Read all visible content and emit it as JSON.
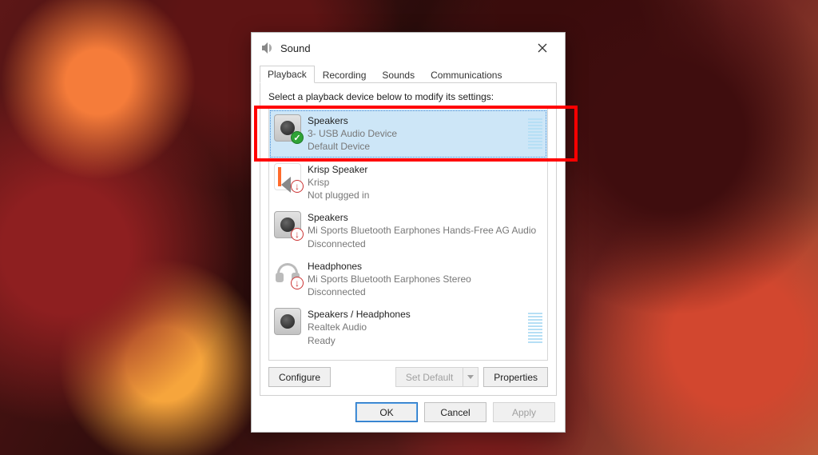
{
  "window": {
    "title": "Sound"
  },
  "tabs": [
    {
      "label": "Playback",
      "active": true
    },
    {
      "label": "Recording",
      "active": false
    },
    {
      "label": "Sounds",
      "active": false
    },
    {
      "label": "Communications",
      "active": false
    }
  ],
  "instruction": "Select a playback device below to modify its settings:",
  "devices": [
    {
      "name": "Speakers",
      "sub1": "3- USB Audio Device",
      "sub2": "Default Device",
      "iconType": "spk",
      "badge": "green",
      "selected": true,
      "vu": "blue"
    },
    {
      "name": "Krisp Speaker",
      "sub1": "Krisp",
      "sub2": "Not plugged in",
      "iconType": "krisp",
      "badge": "red",
      "selected": false,
      "vu": null
    },
    {
      "name": "Speakers",
      "sub1": "Mi Sports Bluetooth Earphones Hands-Free AG Audio",
      "sub2": "Disconnected",
      "iconType": "spk",
      "badge": "red",
      "selected": false,
      "vu": null
    },
    {
      "name": "Headphones",
      "sub1": "Mi Sports Bluetooth Earphones Stereo",
      "sub2": "Disconnected",
      "iconType": "hp",
      "badge": "red",
      "selected": false,
      "vu": null
    },
    {
      "name": "Speakers / Headphones",
      "sub1": "Realtek Audio",
      "sub2": "Ready",
      "iconType": "spk",
      "badge": null,
      "selected": false,
      "vu": "blue"
    }
  ],
  "panelButtons": {
    "configure": "Configure",
    "setDefault": "Set Default",
    "properties": "Properties"
  },
  "dialogButtons": {
    "ok": "OK",
    "cancel": "Cancel",
    "apply": "Apply"
  }
}
